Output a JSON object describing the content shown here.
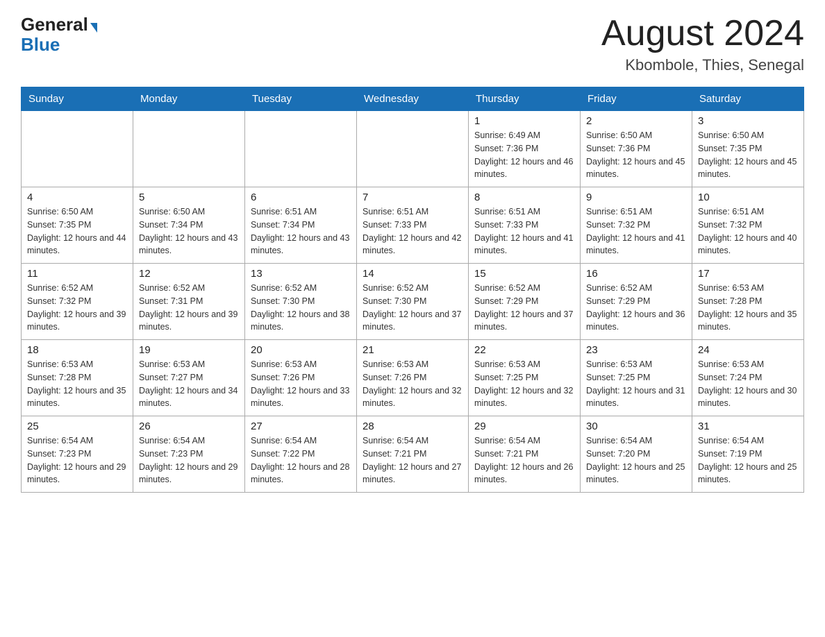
{
  "header": {
    "logo_general": "General",
    "logo_blue": "Blue",
    "month_title": "August 2024",
    "location": "Kbombole, Thies, Senegal"
  },
  "days_of_week": [
    "Sunday",
    "Monday",
    "Tuesday",
    "Wednesday",
    "Thursday",
    "Friday",
    "Saturday"
  ],
  "weeks": [
    [
      {
        "day": "",
        "sunrise": "",
        "sunset": "",
        "daylight": ""
      },
      {
        "day": "",
        "sunrise": "",
        "sunset": "",
        "daylight": ""
      },
      {
        "day": "",
        "sunrise": "",
        "sunset": "",
        "daylight": ""
      },
      {
        "day": "",
        "sunrise": "",
        "sunset": "",
        "daylight": ""
      },
      {
        "day": "1",
        "sunrise": "Sunrise: 6:49 AM",
        "sunset": "Sunset: 7:36 PM",
        "daylight": "Daylight: 12 hours and 46 minutes."
      },
      {
        "day": "2",
        "sunrise": "Sunrise: 6:50 AM",
        "sunset": "Sunset: 7:36 PM",
        "daylight": "Daylight: 12 hours and 45 minutes."
      },
      {
        "day": "3",
        "sunrise": "Sunrise: 6:50 AM",
        "sunset": "Sunset: 7:35 PM",
        "daylight": "Daylight: 12 hours and 45 minutes."
      }
    ],
    [
      {
        "day": "4",
        "sunrise": "Sunrise: 6:50 AM",
        "sunset": "Sunset: 7:35 PM",
        "daylight": "Daylight: 12 hours and 44 minutes."
      },
      {
        "day": "5",
        "sunrise": "Sunrise: 6:50 AM",
        "sunset": "Sunset: 7:34 PM",
        "daylight": "Daylight: 12 hours and 43 minutes."
      },
      {
        "day": "6",
        "sunrise": "Sunrise: 6:51 AM",
        "sunset": "Sunset: 7:34 PM",
        "daylight": "Daylight: 12 hours and 43 minutes."
      },
      {
        "day": "7",
        "sunrise": "Sunrise: 6:51 AM",
        "sunset": "Sunset: 7:33 PM",
        "daylight": "Daylight: 12 hours and 42 minutes."
      },
      {
        "day": "8",
        "sunrise": "Sunrise: 6:51 AM",
        "sunset": "Sunset: 7:33 PM",
        "daylight": "Daylight: 12 hours and 41 minutes."
      },
      {
        "day": "9",
        "sunrise": "Sunrise: 6:51 AM",
        "sunset": "Sunset: 7:32 PM",
        "daylight": "Daylight: 12 hours and 41 minutes."
      },
      {
        "day": "10",
        "sunrise": "Sunrise: 6:51 AM",
        "sunset": "Sunset: 7:32 PM",
        "daylight": "Daylight: 12 hours and 40 minutes."
      }
    ],
    [
      {
        "day": "11",
        "sunrise": "Sunrise: 6:52 AM",
        "sunset": "Sunset: 7:32 PM",
        "daylight": "Daylight: 12 hours and 39 minutes."
      },
      {
        "day": "12",
        "sunrise": "Sunrise: 6:52 AM",
        "sunset": "Sunset: 7:31 PM",
        "daylight": "Daylight: 12 hours and 39 minutes."
      },
      {
        "day": "13",
        "sunrise": "Sunrise: 6:52 AM",
        "sunset": "Sunset: 7:30 PM",
        "daylight": "Daylight: 12 hours and 38 minutes."
      },
      {
        "day": "14",
        "sunrise": "Sunrise: 6:52 AM",
        "sunset": "Sunset: 7:30 PM",
        "daylight": "Daylight: 12 hours and 37 minutes."
      },
      {
        "day": "15",
        "sunrise": "Sunrise: 6:52 AM",
        "sunset": "Sunset: 7:29 PM",
        "daylight": "Daylight: 12 hours and 37 minutes."
      },
      {
        "day": "16",
        "sunrise": "Sunrise: 6:52 AM",
        "sunset": "Sunset: 7:29 PM",
        "daylight": "Daylight: 12 hours and 36 minutes."
      },
      {
        "day": "17",
        "sunrise": "Sunrise: 6:53 AM",
        "sunset": "Sunset: 7:28 PM",
        "daylight": "Daylight: 12 hours and 35 minutes."
      }
    ],
    [
      {
        "day": "18",
        "sunrise": "Sunrise: 6:53 AM",
        "sunset": "Sunset: 7:28 PM",
        "daylight": "Daylight: 12 hours and 35 minutes."
      },
      {
        "day": "19",
        "sunrise": "Sunrise: 6:53 AM",
        "sunset": "Sunset: 7:27 PM",
        "daylight": "Daylight: 12 hours and 34 minutes."
      },
      {
        "day": "20",
        "sunrise": "Sunrise: 6:53 AM",
        "sunset": "Sunset: 7:26 PM",
        "daylight": "Daylight: 12 hours and 33 minutes."
      },
      {
        "day": "21",
        "sunrise": "Sunrise: 6:53 AM",
        "sunset": "Sunset: 7:26 PM",
        "daylight": "Daylight: 12 hours and 32 minutes."
      },
      {
        "day": "22",
        "sunrise": "Sunrise: 6:53 AM",
        "sunset": "Sunset: 7:25 PM",
        "daylight": "Daylight: 12 hours and 32 minutes."
      },
      {
        "day": "23",
        "sunrise": "Sunrise: 6:53 AM",
        "sunset": "Sunset: 7:25 PM",
        "daylight": "Daylight: 12 hours and 31 minutes."
      },
      {
        "day": "24",
        "sunrise": "Sunrise: 6:53 AM",
        "sunset": "Sunset: 7:24 PM",
        "daylight": "Daylight: 12 hours and 30 minutes."
      }
    ],
    [
      {
        "day": "25",
        "sunrise": "Sunrise: 6:54 AM",
        "sunset": "Sunset: 7:23 PM",
        "daylight": "Daylight: 12 hours and 29 minutes."
      },
      {
        "day": "26",
        "sunrise": "Sunrise: 6:54 AM",
        "sunset": "Sunset: 7:23 PM",
        "daylight": "Daylight: 12 hours and 29 minutes."
      },
      {
        "day": "27",
        "sunrise": "Sunrise: 6:54 AM",
        "sunset": "Sunset: 7:22 PM",
        "daylight": "Daylight: 12 hours and 28 minutes."
      },
      {
        "day": "28",
        "sunrise": "Sunrise: 6:54 AM",
        "sunset": "Sunset: 7:21 PM",
        "daylight": "Daylight: 12 hours and 27 minutes."
      },
      {
        "day": "29",
        "sunrise": "Sunrise: 6:54 AM",
        "sunset": "Sunset: 7:21 PM",
        "daylight": "Daylight: 12 hours and 26 minutes."
      },
      {
        "day": "30",
        "sunrise": "Sunrise: 6:54 AM",
        "sunset": "Sunset: 7:20 PM",
        "daylight": "Daylight: 12 hours and 25 minutes."
      },
      {
        "day": "31",
        "sunrise": "Sunrise: 6:54 AM",
        "sunset": "Sunset: 7:19 PM",
        "daylight": "Daylight: 12 hours and 25 minutes."
      }
    ]
  ]
}
